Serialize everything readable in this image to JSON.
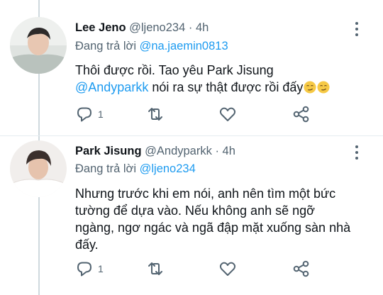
{
  "tweets": [
    {
      "name": "Lee Jeno",
      "handle": "@ljeno234",
      "separator": "·",
      "time": "4h",
      "reply_prefix": "Đang trả lời",
      "reply_to": "@na.jaemin0813",
      "body_line1": "Thôi được rồi. Tao yêu Park Jisung",
      "body_mention": "@Andyparkk",
      "body_rest": "nói ra sự thật được rồi đấy",
      "reply_count": "1",
      "emoji": "smirking-face-emoji"
    },
    {
      "name": "Park Jisung",
      "handle": "@Andyparkk",
      "separator": "·",
      "time": "4h",
      "reply_prefix": "Đang trả lời",
      "reply_to": "@ljeno234",
      "body": "Nhưng trước khi em nói, anh nên tìm một bức tường để dựa vào. Nếu không anh sẽ ngỡ ngàng, ngơ ngác và ngã đập mặt xuống sàn nhà đấy.",
      "reply_count": "1"
    }
  ],
  "colors": {
    "accent": "#1d9bf0",
    "secondary_text": "#536471",
    "primary_text": "#0f1419",
    "line": "#cfd9de"
  }
}
